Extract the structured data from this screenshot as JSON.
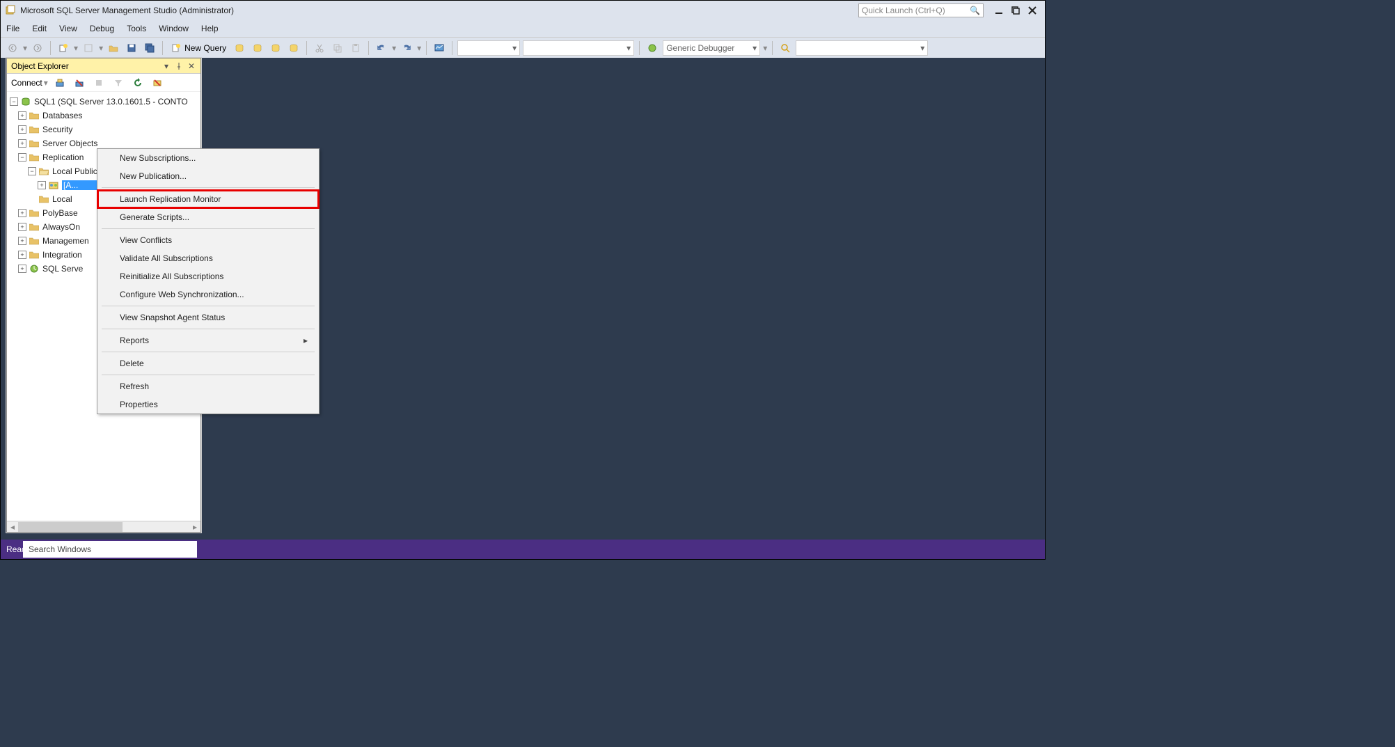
{
  "title": "Microsoft SQL Server Management Studio (Administrator)",
  "quicklaunch_placeholder": "Quick Launch (Ctrl+Q)",
  "menubar": [
    "File",
    "Edit",
    "View",
    "Debug",
    "Tools",
    "Window",
    "Help"
  ],
  "toolbar": {
    "newquery": "New Query",
    "debugger_combo": "Generic Debugger"
  },
  "objexp": {
    "title": "Object Explorer",
    "connect": "Connect",
    "server": "SQL1 (SQL Server 13.0.1601.5 - CONTO",
    "nodes": {
      "databases": "Databases",
      "security": "Security",
      "server_objects": "Server Objects",
      "replication": "Replication",
      "local_publications": "Local Publications",
      "publication_item": "[A...",
      "local_subs": "Local",
      "polybase": "PolyBase",
      "alwayson": "AlwaysOn",
      "management": "Managemen",
      "integration": "Integration",
      "sqlagent": "SQL Serve"
    }
  },
  "contextmenu": {
    "new_subscriptions": "New Subscriptions...",
    "new_publication": "New Publication...",
    "launch_replication_monitor": "Launch Replication Monitor",
    "generate_scripts": "Generate Scripts...",
    "view_conflicts": "View Conflicts",
    "validate_all": "Validate All Subscriptions",
    "reinitialize_all": "Reinitialize All Subscriptions",
    "configure_web_sync": "Configure Web Synchronization...",
    "view_snapshot_status": "View Snapshot Agent Status",
    "reports": "Reports",
    "delete": "Delete",
    "refresh": "Refresh",
    "properties": "Properties"
  },
  "taskbar": {
    "ready": "Ready",
    "search": "Search Windows"
  }
}
